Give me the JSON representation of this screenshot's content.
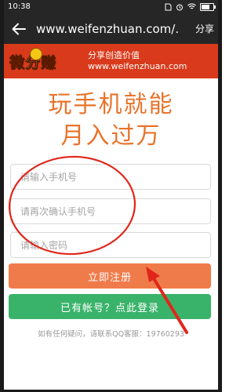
{
  "status_bar": {
    "time": "10:38"
  },
  "app_bar": {
    "title": "www.weifenzhuan.com/.",
    "share_label": "分享"
  },
  "banner": {
    "logo_text": "微分赚",
    "slogan": "分享创造价值",
    "url": "www.weifenzhuan.com"
  },
  "headline": "玩手机就能月入过万",
  "form": {
    "phone_placeholder": "请输入手机号",
    "confirm_placeholder": "请再次确认手机号",
    "password_placeholder": "请输入密码"
  },
  "buttons": {
    "register": "立即注册",
    "login": "已有帐号？点此登录"
  },
  "footer": "如有任何疑问，请联系QQ客服：19760293",
  "colors": {
    "status_bar": "#262626",
    "banner": "#d93a1b",
    "headline": "#e8732a",
    "register_button": "#f07b4a",
    "login_button": "#3ab36a",
    "annotation_red": "#e0261b"
  },
  "icons": [
    "back-arrow-icon",
    "alarm-icon",
    "wifi-icon",
    "battery-icon",
    "sim-icon"
  ]
}
